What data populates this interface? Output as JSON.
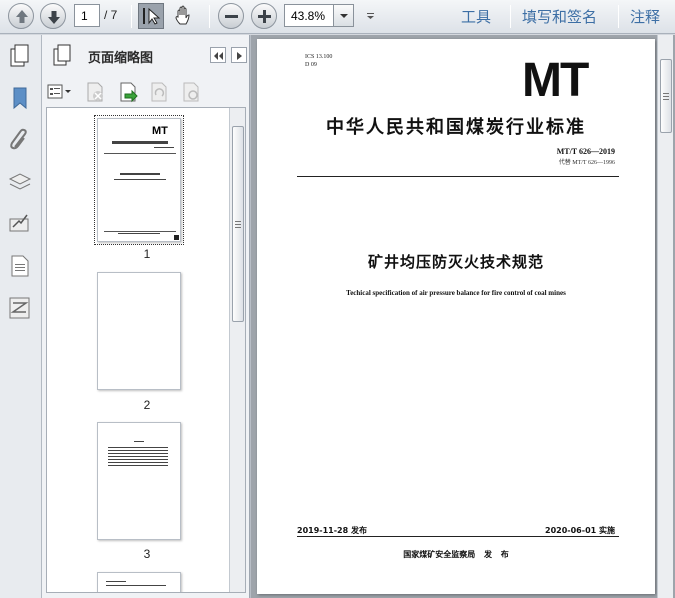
{
  "toolbar": {
    "current_page": "1",
    "page_total": "/ 7",
    "zoom": "43.8%",
    "links": [
      "工具",
      "填写和签名",
      "注释"
    ]
  },
  "panel": {
    "title": "页面缩略图",
    "thumbnails": [
      {
        "label": "1"
      },
      {
        "label": "2"
      },
      {
        "label": "3"
      }
    ]
  },
  "document": {
    "ics": "ICS 13.100",
    "ccs": "D 09",
    "logo": "MT",
    "org_title": "中华人民共和国煤炭行业标准",
    "code": "MT/T 626—2019",
    "replaces": "代替 MT/T 626—1996",
    "title_cn": "矿井均压防灭火技术规范",
    "title_en": "Techical specification of air pressure balance for fire control of coal mines",
    "publish_date": "2019-11-28 发布",
    "effective_date": "2020-06-01 实施",
    "issuer": "国家煤矿安全监察局 发 布"
  },
  "icons": {
    "rail": [
      "pages-icon",
      "bookmark-icon",
      "attachment-icon",
      "layers-icon",
      "signature-icon",
      "document-properties-icon",
      "compare-icon"
    ]
  }
}
